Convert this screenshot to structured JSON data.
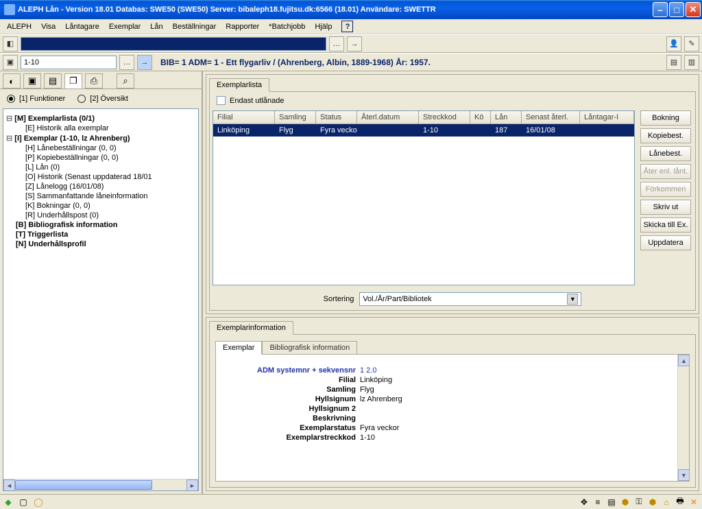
{
  "title": "ALEPH Lån - Version 18.01  Databas:  SWE50 (SWE50)  Server:  bibaleph18.fujitsu.dk:6566 (18.01)  Användare:  SWETTR",
  "menu": {
    "m1": "ALEPH",
    "m2": "Visa",
    "m3": "Låntagare",
    "m4": "Exemplar",
    "m5": "Lån",
    "m6": "Beställningar",
    "m7": "Rapporter",
    "m8": "*Batchjobb",
    "m9": "Hjälp"
  },
  "toolbar": {
    "field2_value": "1-10"
  },
  "bib_line": "BIB= 1 ADM= 1 - Ett flygarliv / (Ahrenberg, Albin, 1889-1968) År: 1957.",
  "left": {
    "radio1": "[1] Funktioner",
    "radio2": "[2] Översikt",
    "t0": "[M] Exemplarlista (0/1)",
    "t1": "[E] Historik alla exemplar",
    "t2": "[I] Exemplar (1-10, lz Ahrenberg)",
    "t3": "[H] Lånebeställningar (0, 0)",
    "t4": "[P] Kopiebeställningar (0, 0)",
    "t5": "[L] Lån (0)",
    "t6": "[O] Historik (Senast uppdaterad 18/01",
    "t7": "[Z] Lånelogg (16/01/08)",
    "t8": "[S] Sammanfattande låneinformation",
    "t9": "[K] Bokningar (0, 0)",
    "t10": "[R] Underhållspost (0)",
    "t11": "[B] Bibliografisk information",
    "t12": "[T] Triggerlista",
    "t13": "[N] Underhållsprofil"
  },
  "exemplar_tab": "Exemplarlista",
  "only_loaned": "Endast utlånade",
  "cols": {
    "c1": "Filial",
    "c2": "Samling",
    "c3": "Status",
    "c4": "Återl.datum",
    "c5": "Streckkod",
    "c6": "Kö",
    "c7": "Lån",
    "c8": "Senast återl.",
    "c9": "Låntagar-I"
  },
  "row": {
    "c1": "Linköping",
    "c2": "Flyg",
    "c3": "Fyra veckor",
    "c4": "",
    "c5": "1-10",
    "c6": "",
    "c7": "187",
    "c8": "16/01/08",
    "c9": ""
  },
  "buttons": {
    "b1": "Bokning",
    "b2": "Kopiebest.",
    "b3": "Lånebest.",
    "b4": "Åter enl. lånt.",
    "b5": "Förkommen",
    "b6": "Skriv ut",
    "b7": "Skicka till Ex.",
    "b8": "Uppdatera"
  },
  "sort_label": "Sortering",
  "sort_value": "Vol./År/Part/Bibliotek",
  "info_tab": "Exemplarinformation",
  "inner_tabs": {
    "t1": "Exemplar",
    "t2": "Bibliografisk information"
  },
  "kv": {
    "l1": "ADM systemnr + sekvensnr",
    "v1": "1 2.0",
    "l2": "Filial",
    "v2": "Linköping",
    "l3": "Samling",
    "v3": "Flyg",
    "l4": "Hyllsignum",
    "v4": "lz Ahrenberg",
    "l5": "Hyllsignum 2",
    "v5": "",
    "l6": "Beskrivning",
    "v6": "",
    "l7": "Exemplarstatus",
    "v7": "Fyra veckor",
    "l8": "Exemplarstreckkod",
    "v8": "1-10"
  }
}
